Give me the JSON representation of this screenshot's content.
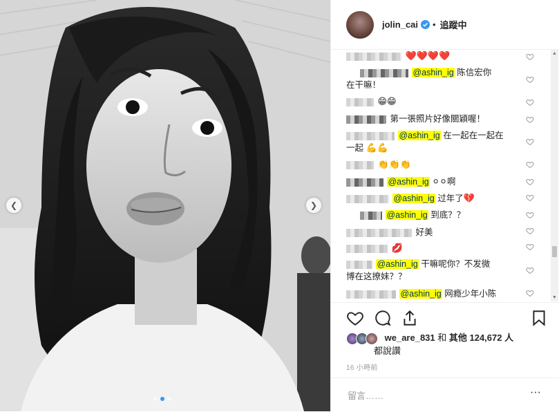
{
  "header": {
    "username": "jolin_cai",
    "separator": "•",
    "follow_status": "追蹤中"
  },
  "comments": [
    {
      "text": "",
      "emoji": "❤️❤️❤️❤️"
    },
    {
      "mention": "@ashin_ig",
      "text": " 陈信宏你",
      "cont": "在干嘛！"
    },
    {
      "text": "",
      "emoji": "😁😁"
    },
    {
      "text": "第一張照片好像關穎喔！"
    },
    {
      "mention": "@ashin_ig",
      "text": " 在一起在一起在",
      "cont": "一起",
      "emoji2": "💪💪"
    },
    {
      "text": "",
      "emoji": "👏👏👏"
    },
    {
      "mention": "@ashin_ig",
      "text": " ",
      "emoji": "⚪⚪",
      "text2": "啊"
    },
    {
      "mention": "@ashin_ig",
      "text": " 过年了",
      "emoji": "💔"
    },
    {
      "mention": "@ashin_ig",
      "text": " 到底？？"
    },
    {
      "text": "好美"
    },
    {
      "text": "",
      "emoji": "💋"
    },
    {
      "mention": "@ashin_ig",
      "text": " 干嘛呢你？不发微",
      "cont": "博在这撩妹？？"
    },
    {
      "mention": "@ashin_ig",
      "text": " 网瘾少年小陈"
    }
  ],
  "likes": {
    "first_liker": "we_are_831",
    "connector": " 和 ",
    "others_label": "其他 124,672 人",
    "suffix": "都說讚"
  },
  "timestamp": "16 小時前",
  "add_comment": {
    "placeholder": "留言……"
  },
  "more_label": "···",
  "colors": {
    "mention_highlight": "#ffff00",
    "verified": "#3897f0",
    "heart": "#e0245e"
  },
  "icons": [
    "heart-icon",
    "comment-icon",
    "share-icon",
    "bookmark-icon",
    "verified-badge-icon",
    "chevron-left-icon",
    "chevron-right-icon"
  ]
}
